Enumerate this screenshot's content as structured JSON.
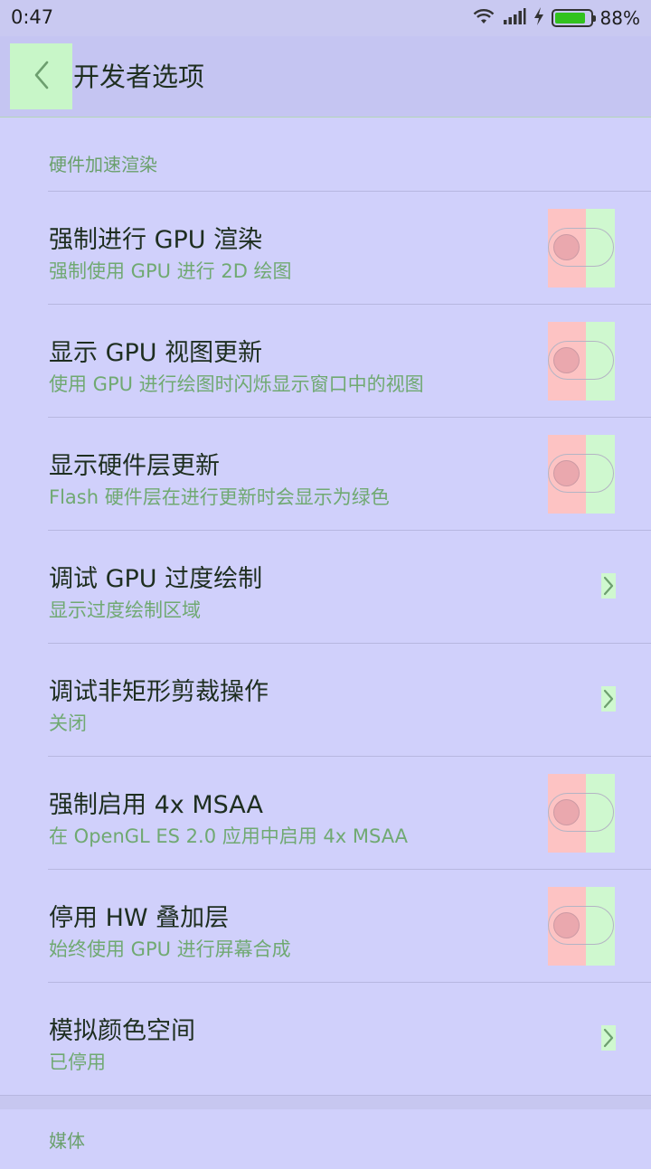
{
  "status": {
    "time": "0:47",
    "battery_percent": "88%",
    "battery_level": 0.88
  },
  "header": {
    "title": "开发者选项",
    "back_icon": "chevron-left-icon"
  },
  "section_hw": {
    "label": "硬件加速渲染"
  },
  "items": [
    {
      "title": "强制进行 GPU 渲染",
      "summary": "强制使用 GPU 进行 2D 绘图",
      "control": "toggle",
      "on": false
    },
    {
      "title": "显示 GPU 视图更新",
      "summary": "使用 GPU 进行绘图时闪烁显示窗口中的视图",
      "control": "toggle",
      "on": false
    },
    {
      "title": "显示硬件层更新",
      "summary": "Flash 硬件层在进行更新时会显示为绿色",
      "control": "toggle",
      "on": false
    },
    {
      "title": "调试 GPU 过度绘制",
      "summary": "显示过度绘制区域",
      "control": "chevron"
    },
    {
      "title": "调试非矩形剪裁操作",
      "summary": "关闭",
      "control": "chevron"
    },
    {
      "title": "强制启用 4x MSAA",
      "summary": "在 OpenGL ES 2.0 应用中启用 4x MSAA",
      "control": "toggle",
      "on": false
    },
    {
      "title": "停用 HW 叠加层",
      "summary": "始终使用 GPU 进行屏幕合成",
      "control": "toggle",
      "on": false
    },
    {
      "title": "模拟颜色空间",
      "summary": "已停用",
      "control": "chevron"
    }
  ],
  "section_media": {
    "label": "媒体"
  },
  "colors": {
    "background": "#d0d0fb",
    "title_text": "#1e2e20",
    "summary_text": "#70a972"
  }
}
